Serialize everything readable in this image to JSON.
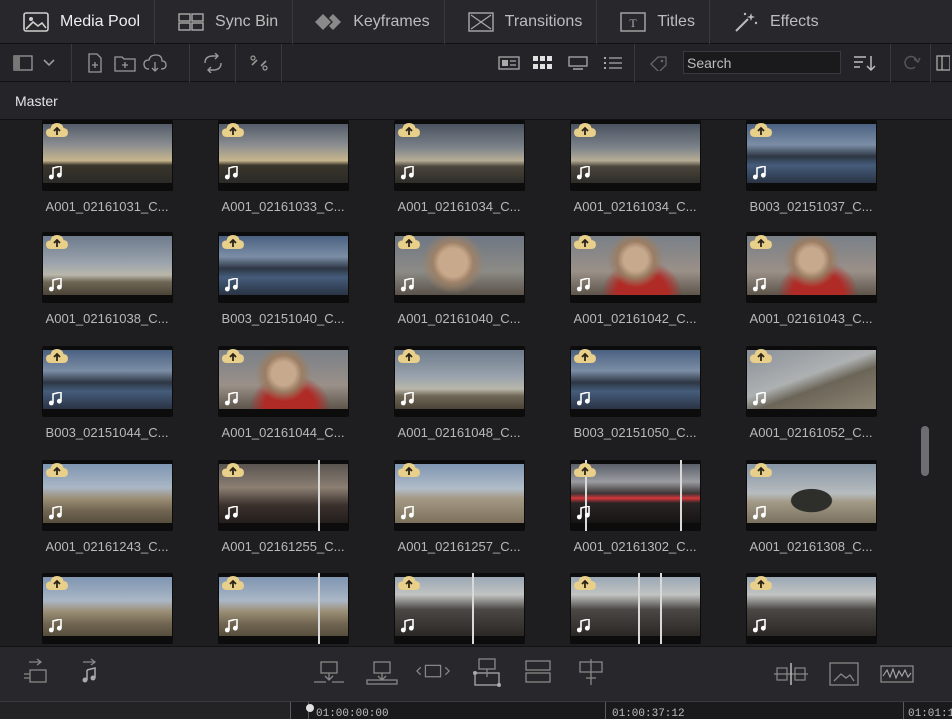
{
  "tabs": [
    {
      "label": "Media Pool",
      "icon": "media-pool-icon",
      "active": true
    },
    {
      "label": "Sync Bin",
      "icon": "sync-bin-icon",
      "active": false
    },
    {
      "label": "Keyframes",
      "icon": "keyframes-icon",
      "active": false
    },
    {
      "label": "Transitions",
      "icon": "transitions-icon",
      "active": false
    },
    {
      "label": "Titles",
      "icon": "titles-icon",
      "active": false
    },
    {
      "label": "Effects",
      "icon": "effects-icon",
      "active": false
    }
  ],
  "toolbar": {
    "search_placeholder": "Search"
  },
  "breadcrumb": "Master",
  "clips": [
    {
      "name": "A001_02161031_C...",
      "scene": "sunset"
    },
    {
      "name": "A001_02161033_C...",
      "scene": "sunset"
    },
    {
      "name": "A001_02161034_C...",
      "scene": "clouds"
    },
    {
      "name": "A001_02161034_C...",
      "scene": "clouds"
    },
    {
      "name": "B003_02151037_C...",
      "scene": "coast"
    },
    {
      "name": "A001_02161038_C...",
      "scene": "sky"
    },
    {
      "name": "B003_02151040_C...",
      "scene": "coast"
    },
    {
      "name": "A001_02161040_C...",
      "scene": "portrait"
    },
    {
      "name": "A001_02161042_C...",
      "scene": "portrait-red"
    },
    {
      "name": "A001_02161043_C...",
      "scene": "portrait-red"
    },
    {
      "name": "B003_02151044_C...",
      "scene": "coast"
    },
    {
      "name": "A001_02161044_C...",
      "scene": "portrait-red"
    },
    {
      "name": "A001_02161048_C...",
      "scene": "sky"
    },
    {
      "name": "B003_02151050_C...",
      "scene": "coast"
    },
    {
      "name": "A001_02161052_C...",
      "scene": "road"
    },
    {
      "name": "A001_02161243_C...",
      "scene": "desert"
    },
    {
      "name": "A001_02161255_C...",
      "scene": "car"
    },
    {
      "name": "A001_02161257_C...",
      "scene": "desert-road"
    },
    {
      "name": "A001_02161302_C...",
      "scene": "car-red"
    },
    {
      "name": "A001_02161308_C...",
      "scene": "hill"
    },
    {
      "name": "",
      "scene": "desert"
    },
    {
      "name": "",
      "scene": "desert"
    },
    {
      "name": "",
      "scene": "car-interior"
    },
    {
      "name": "",
      "scene": "car-interior"
    },
    {
      "name": "",
      "scene": "car-interior"
    }
  ],
  "timeline": {
    "timecodes": [
      "01:00:00:00",
      "01:00:37:12",
      "01:01:1"
    ]
  }
}
